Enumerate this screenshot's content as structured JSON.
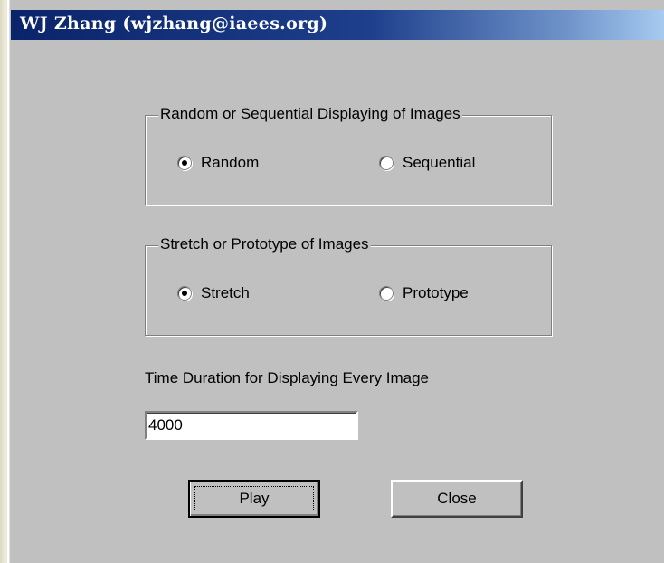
{
  "window": {
    "title": "WJ Zhang (wjzhang@iaees.org)"
  },
  "display_mode": {
    "legend": "Random or Sequential Displaying of Images",
    "options": [
      {
        "label": "Random",
        "selected": true
      },
      {
        "label": "Sequential",
        "selected": false
      }
    ]
  },
  "image_fit": {
    "legend": "Stretch or Prototype of Images",
    "options": [
      {
        "label": "Stretch",
        "selected": true
      },
      {
        "label": "Prototype",
        "selected": false
      }
    ]
  },
  "duration": {
    "label": "Time Duration for Displaying Every Image",
    "value": "4000"
  },
  "buttons": {
    "play": "Play",
    "close": "Close"
  }
}
